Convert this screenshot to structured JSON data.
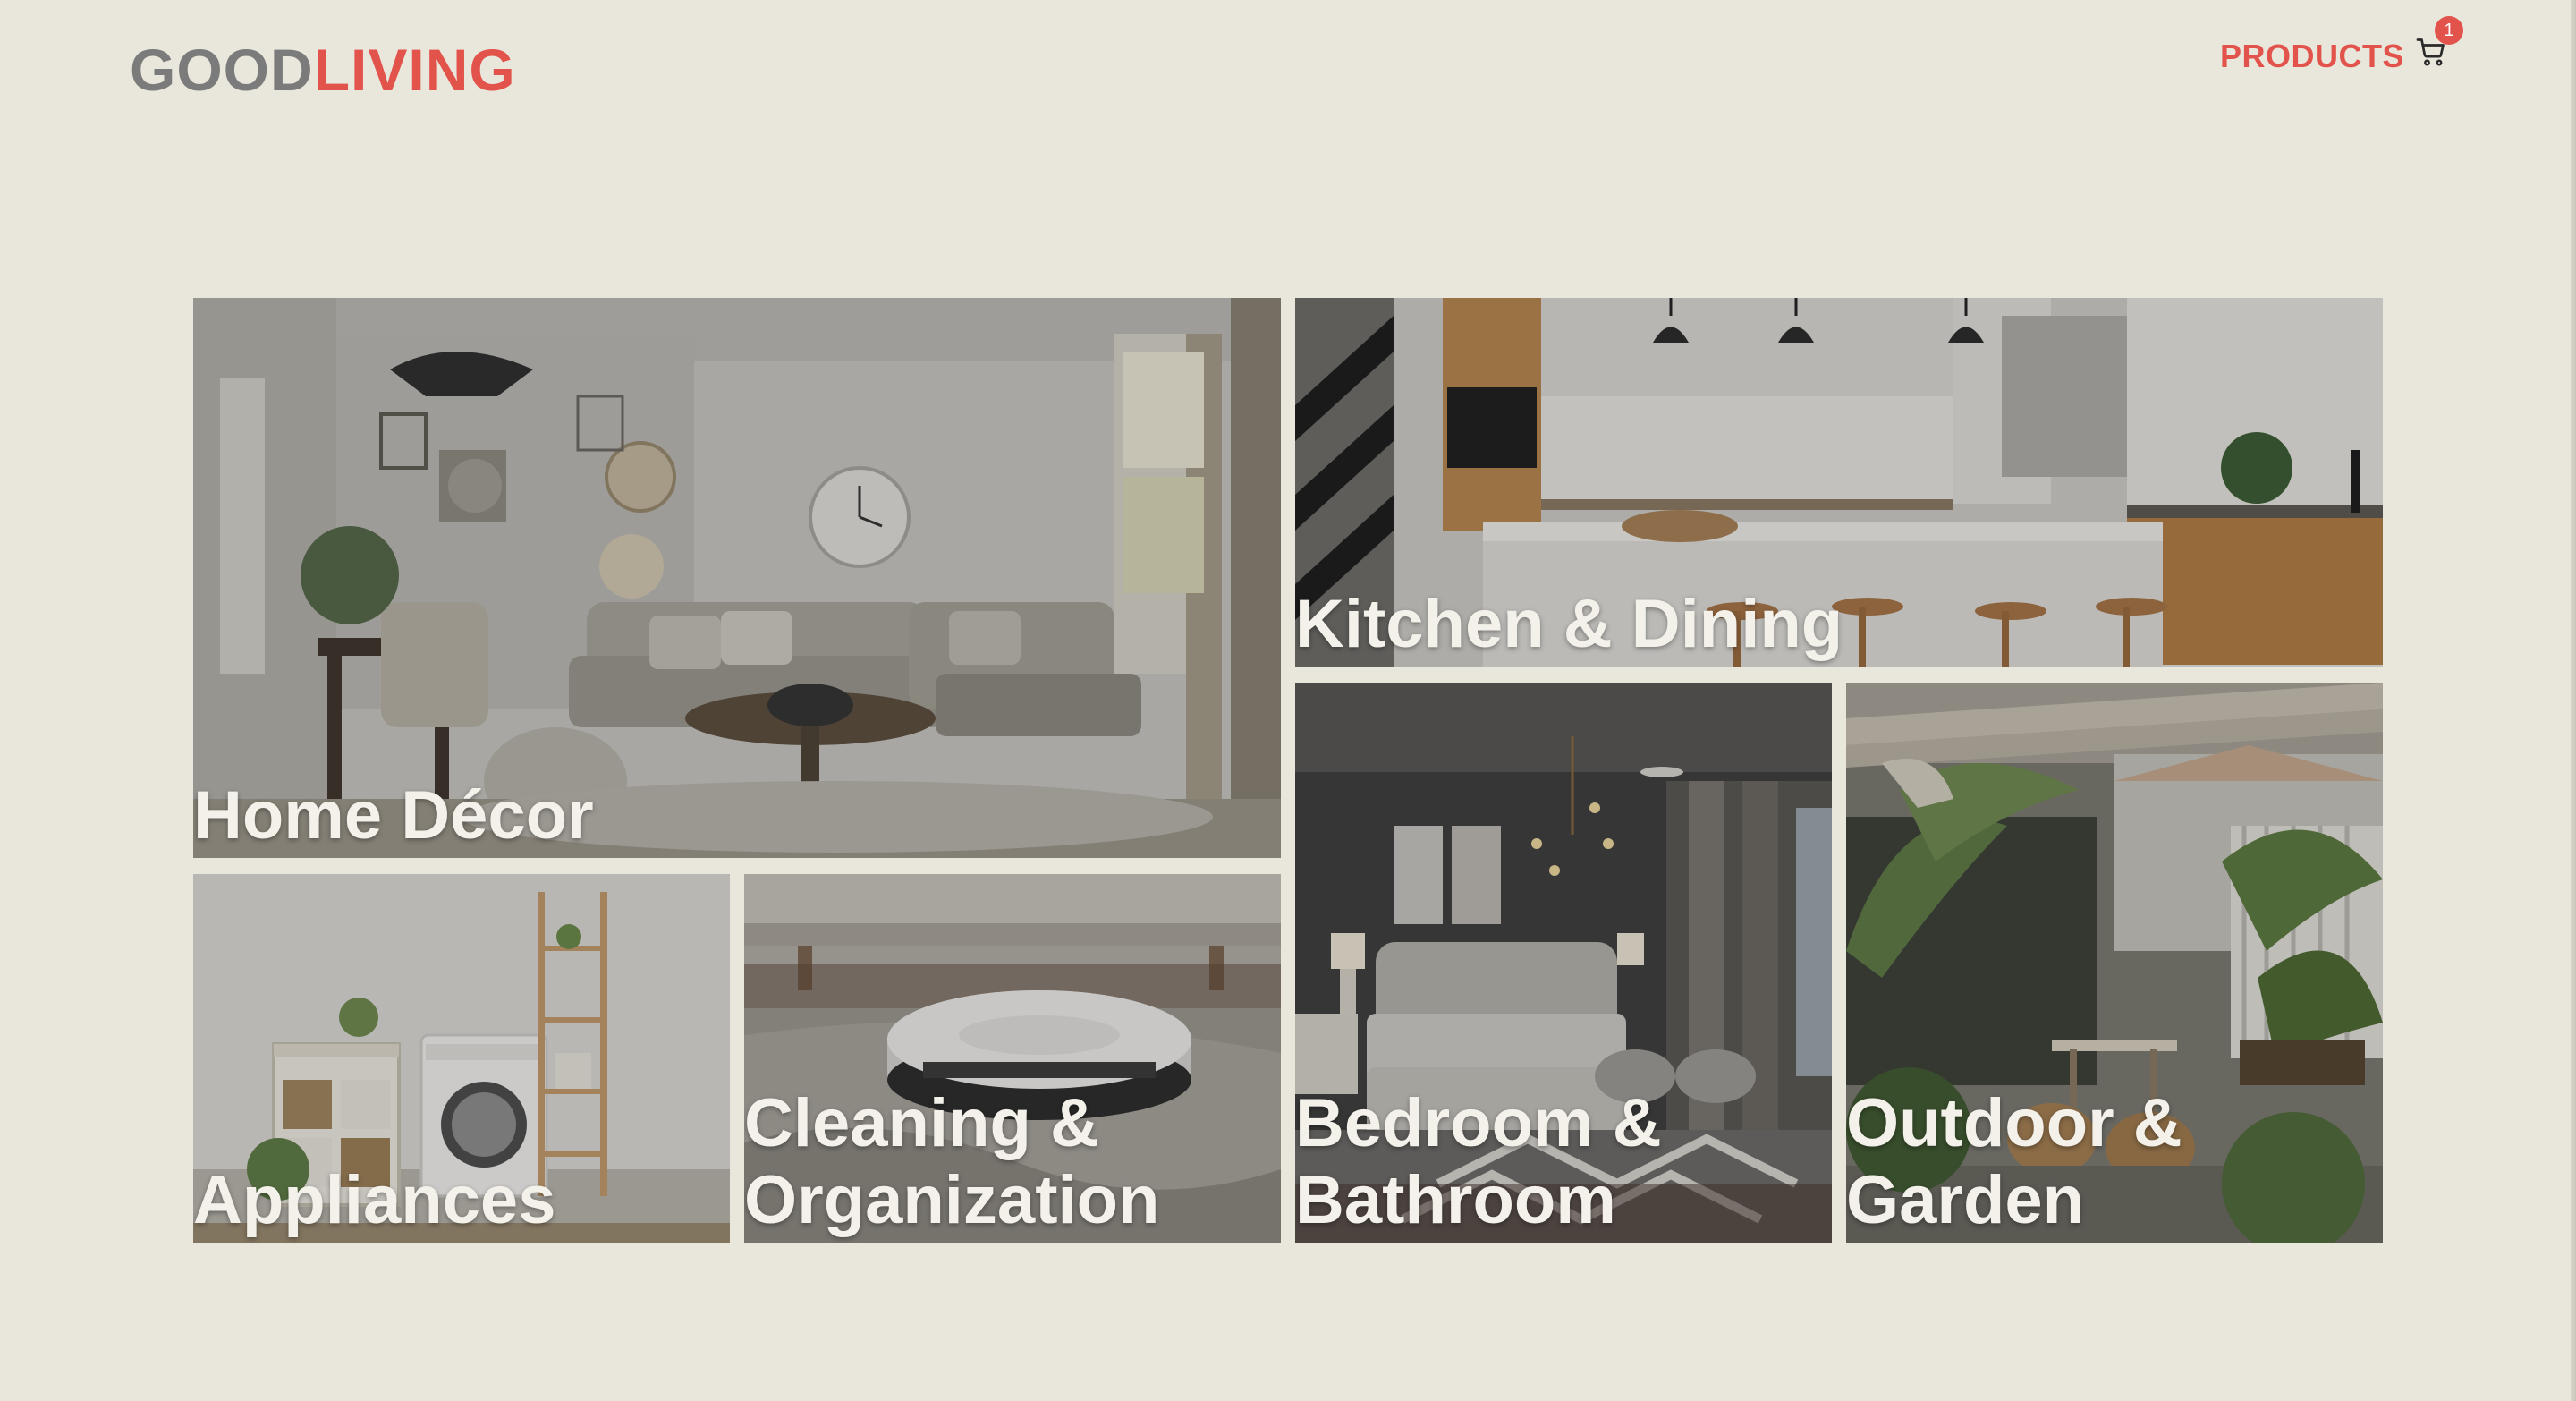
{
  "brand": {
    "logo_part1": "GOOD",
    "logo_part2": "LIVING",
    "color_gray": "#7b7b7b",
    "color_accent": "#e2534b"
  },
  "nav": {
    "products_label": "PRODUCTS",
    "cart_icon": "shopping-cart-icon",
    "cart_count": "1"
  },
  "categories": [
    {
      "label": "Home Décor",
      "scene": "living-room"
    },
    {
      "label": "Kitchen & Dining",
      "scene": "kitchen"
    },
    {
      "label": "Bedroom &\nBathroom",
      "scene": "bedroom"
    },
    {
      "label": "Outdoor & Garden",
      "scene": "patio"
    },
    {
      "label": "Appliances",
      "scene": "laundry"
    },
    {
      "label": "Cleaning &\nOrganization",
      "scene": "robot-vacuum"
    }
  ],
  "colors": {
    "page_background": "#e9e6dc",
    "label_text": "#f3f1ea"
  }
}
